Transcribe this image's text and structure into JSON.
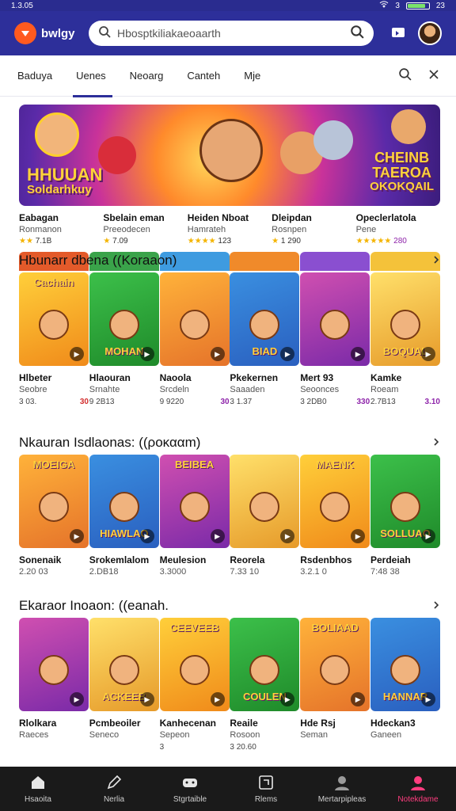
{
  "status": {
    "time": "1.3.05",
    "signal": "3",
    "battery_pct": 0.85,
    "battery_label": "23"
  },
  "header": {
    "logo_text": "bwlgy",
    "search": {
      "value": "Hbosptkiliakaeoaarth",
      "placeholder": ""
    },
    "icons": [
      "search-icon",
      "cast-icon",
      "avatar"
    ]
  },
  "tabs": [
    "Baduya",
    "Uenes",
    "Neoarg",
    "Canteh",
    "Mje"
  ],
  "active_tab": 1,
  "banner": {
    "left_title": "HHUUAN",
    "left_sub": "Soldarhkuy",
    "right_title": "CHEINB",
    "right_sub": "TAEROA",
    "right_sub2": "OKOKQAIL"
  },
  "featured_strip": [
    {
      "name": "Eabagan",
      "sub": "Ronmanon",
      "rating": "7.1B"
    },
    {
      "name": "Sbelain eman",
      "sub": "Preeodecen",
      "rating": "7.09"
    },
    {
      "name": "Heiden Nboat",
      "sub": "Hamrateh",
      "rating": "123"
    },
    {
      "name": "Dleipdan",
      "sub": "Rosnpen",
      "rating": "1 290"
    },
    {
      "name": "Opeclerlatola",
      "sub": "Pene",
      "rating": "280"
    }
  ],
  "sections": [
    {
      "title": "Hbunarr dbena ((Koraaon)",
      "cards": [
        {
          "name": "Hlbeter",
          "sub": "Seobre",
          "meta": "3 03.",
          "pill": "30",
          "label": "Cachain",
          "pill_color": "#d32f2f"
        },
        {
          "name": "Hlaouran",
          "sub": "Srnahte",
          "meta": "9 2B13",
          "pill": "",
          "label": "MOHAN",
          "pill_color": "#333"
        },
        {
          "name": "Naoola",
          "sub": "Srcdeln",
          "meta": "9 9220",
          "pill": "30",
          "label": "",
          "pill_color": "#8e24aa"
        },
        {
          "name": "Pkekernen",
          "sub": "Saaaden",
          "meta": "3 1.37",
          "pill": "",
          "label": "BIAD",
          "pill_color": "#333"
        },
        {
          "name": "Mert 93",
          "sub": "Seoonces",
          "meta": "3 2DB0",
          "pill": "330",
          "label": "",
          "pill_color": "#8e24aa"
        },
        {
          "name": "Kamke",
          "sub": "Roeam",
          "meta": "2.7B13",
          "pill": "3.10",
          "label": "BOQUAL",
          "pill_color": "#8e24aa"
        }
      ]
    },
    {
      "title": "Nkauran Isdlaonas: ((ροκααm)",
      "cards": [
        {
          "name": "Sonenaik",
          "sub": "2.20 03",
          "meta": "",
          "pill": "",
          "label": "MOEIGA",
          "pill_color": "#333"
        },
        {
          "name": "Srokemlalom",
          "sub": "2.DB18",
          "meta": "",
          "pill": "",
          "label": "HIAWLAO",
          "pill_color": "#333"
        },
        {
          "name": "Meulesion",
          "sub": "3.3000",
          "meta": "",
          "pill": "",
          "label": "BEIBEA",
          "pill_color": "#333"
        },
        {
          "name": "Reorela",
          "sub": "7.33 10",
          "meta": "",
          "pill": "",
          "label": "",
          "pill_color": "#333"
        },
        {
          "name": "Rsdenbhos",
          "sub": "3.2.1 0",
          "meta": "",
          "pill": "",
          "label": "MAENK",
          "pill_color": "#333"
        },
        {
          "name": "Perdeiah",
          "sub": "7:48 38",
          "meta": "",
          "pill": "",
          "label": "SOLLUAO",
          "pill_color": "#333"
        }
      ]
    },
    {
      "title": "Ekaraor Inoaon: ((eanah.",
      "cards": [
        {
          "name": "Rlolkara",
          "sub": "Raeces",
          "meta": "",
          "pill": "",
          "label": "",
          "pill_color": "#333"
        },
        {
          "name": "Pcmbeoiler",
          "sub": "Seneco",
          "meta": "",
          "pill": "",
          "label": "ACKEEB",
          "pill_color": "#333"
        },
        {
          "name": "Kanhecenan",
          "sub": "Sepeon",
          "meta": "3",
          "pill": "",
          "label": "CEEVEEB",
          "pill_color": "#333"
        },
        {
          "name": "Reaile",
          "sub": "Rosoon",
          "meta": "3 20.60",
          "pill": "",
          "label": "COULEN",
          "pill_color": "#333"
        },
        {
          "name": "Hde Rsj",
          "sub": "Seman",
          "meta": "",
          "pill": "",
          "label": "BOLIAAD",
          "pill_color": "#333"
        },
        {
          "name": "Hdeckan3",
          "sub": "Ganeen",
          "meta": "",
          "pill": "",
          "label": "HANNAR",
          "pill_color": "#333"
        }
      ]
    }
  ],
  "bottom_nav": [
    {
      "label": "Hsaoita",
      "icon": "home-icon"
    },
    {
      "label": "Nerlia",
      "icon": "pen-icon"
    },
    {
      "label": "Stgrtaible",
      "icon": "gamepad-icon"
    },
    {
      "label": "Rlems",
      "icon": "square-icon"
    },
    {
      "label": "Mertarpipleas",
      "icon": "user-icon"
    },
    {
      "label": "Notekdame",
      "icon": "profile-pink-icon"
    }
  ],
  "active_nav": 5,
  "colors": {
    "brand": "#2d2f9a",
    "accent": "#ff3d7f",
    "logo": "#ff5a1f"
  }
}
